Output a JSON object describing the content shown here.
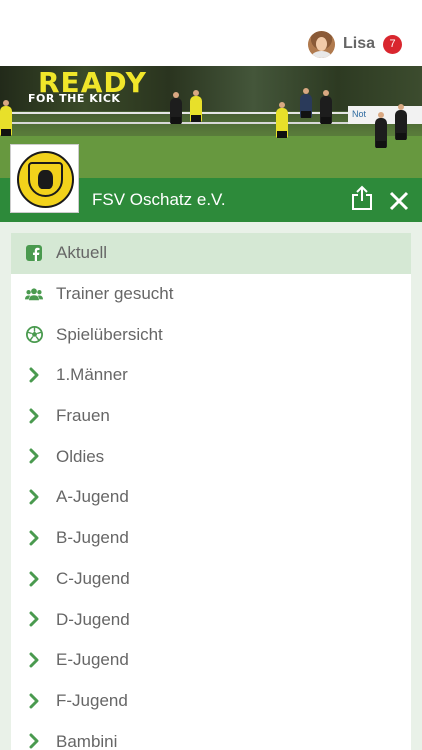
{
  "header": {
    "user_name": "Lisa",
    "notification_count": "7"
  },
  "hero": {
    "title": "READY",
    "subtitle": "FOR THE KICK",
    "sponsor_text": "Not"
  },
  "club": {
    "name": "FSV Oschatz e.V."
  },
  "colors": {
    "brand_green": "#2d8a3a",
    "active_row": "#d5e8d4",
    "badge_red": "#d9262e",
    "text_gray": "#666666"
  },
  "menu": {
    "items": [
      {
        "label": "Aktuell",
        "icon": "facebook-icon",
        "active": true
      },
      {
        "label": "Trainer gesucht",
        "icon": "people-icon",
        "active": false
      },
      {
        "label": "Spielübersicht",
        "icon": "soccer-ball-icon",
        "active": false
      },
      {
        "label": "1.Männer",
        "icon": "chevron-right-icon",
        "active": false
      },
      {
        "label": "Frauen",
        "icon": "chevron-right-icon",
        "active": false
      },
      {
        "label": "Oldies",
        "icon": "chevron-right-icon",
        "active": false
      },
      {
        "label": "A-Jugend",
        "icon": "chevron-right-icon",
        "active": false
      },
      {
        "label": "B-Jugend",
        "icon": "chevron-right-icon",
        "active": false
      },
      {
        "label": "C-Jugend",
        "icon": "chevron-right-icon",
        "active": false
      },
      {
        "label": "D-Jugend",
        "icon": "chevron-right-icon",
        "active": false
      },
      {
        "label": "E-Jugend",
        "icon": "chevron-right-icon",
        "active": false
      },
      {
        "label": "F-Jugend",
        "icon": "chevron-right-icon",
        "active": false
      },
      {
        "label": "Bambini",
        "icon": "chevron-right-icon",
        "active": false
      }
    ]
  }
}
